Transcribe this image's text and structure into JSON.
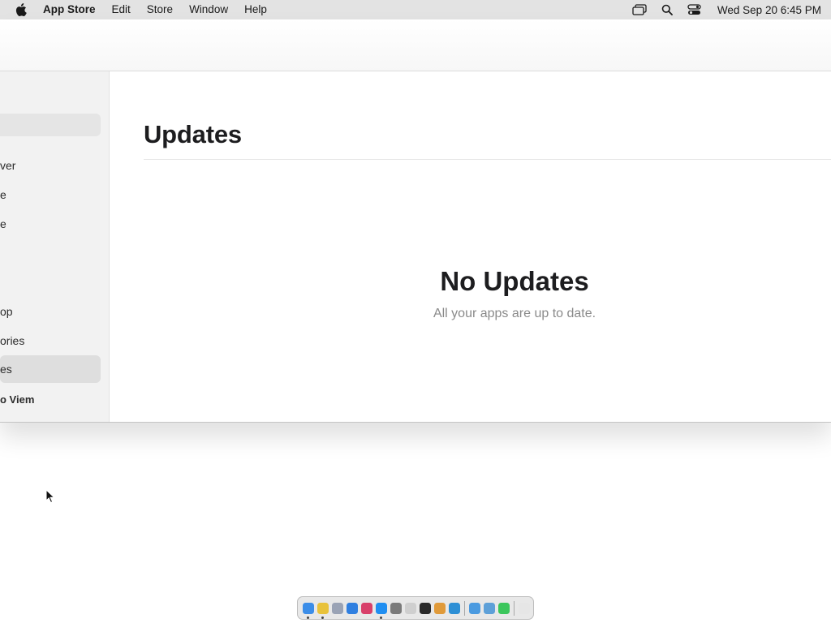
{
  "menubar": {
    "app_name": "App Store",
    "menus": [
      "Edit",
      "Store",
      "Window",
      "Help"
    ],
    "clock": "Wed Sep 20  6:45 PM",
    "icons": [
      "apple-icon",
      "screen-mirroring-icon",
      "search-icon",
      "control-center-icon"
    ]
  },
  "sidebar": {
    "items": [
      {
        "label": "ver"
      },
      {
        "label": "e"
      },
      {
        "label": "e"
      },
      {
        "label": "op"
      },
      {
        "label": "ories"
      },
      {
        "label": "es"
      }
    ],
    "account": "o Viem"
  },
  "main": {
    "title": "Updates",
    "empty_title": "No Updates",
    "empty_subtitle": "All your apps are up to date."
  },
  "dock": {
    "apps": [
      {
        "name": "finder-icon",
        "color": "#3b8de8"
      },
      {
        "name": "chrome-icon",
        "color": "#e8c23b"
      },
      {
        "name": "launchpad-icon",
        "color": "#9aa3b5"
      },
      {
        "name": "safari-icon",
        "color": "#2f7fe0"
      },
      {
        "name": "photo-app-icon",
        "color": "#d8406a"
      },
      {
        "name": "app-store-icon",
        "color": "#1f8ef1"
      },
      {
        "name": "system-settings-icon",
        "color": "#7a7a7a"
      },
      {
        "name": "pencil-app-icon",
        "color": "#cfcfcf"
      },
      {
        "name": "terminal-icon",
        "color": "#2a2a2a"
      },
      {
        "name": "instrument-app-icon",
        "color": "#e09a3a"
      },
      {
        "name": "vscode-icon",
        "color": "#2d8fd5"
      },
      {
        "name": "finder-window-icon",
        "color": "#4a9ae0"
      },
      {
        "name": "preview-icon",
        "color": "#5ea0d8"
      },
      {
        "name": "messages-icon",
        "color": "#3cc65c"
      },
      {
        "name": "trash-icon",
        "color": "#e6e6e6"
      }
    ]
  }
}
